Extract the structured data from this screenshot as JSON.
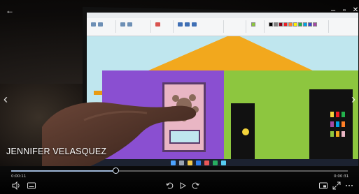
{
  "caption": "JENNIFER VELASQUEZ",
  "time": {
    "elapsed": "0:00:11",
    "remaining": "0:00:31"
  },
  "progress": 0.31,
  "window_controls": {
    "minimize": "–",
    "maximize": "▫",
    "close": "✕"
  },
  "nav": {
    "prev": "‹",
    "next": "›"
  },
  "controls": {
    "volume": "volume-icon",
    "subtitles": "subtitles-icon",
    "skip_back": "rewind-icon",
    "play": "play-icon",
    "skip_forward": "forward-icon",
    "miniplayer": "miniplayer-icon",
    "fullscreen": "fullscreen-icon",
    "more": "more-icon"
  },
  "colors": {
    "roof": "#f2a81d",
    "purple_wall": "#8a4fd1",
    "green_wall": "#8dc63f",
    "sky": "#bfe6ee",
    "accent": "#9fb7d8"
  }
}
